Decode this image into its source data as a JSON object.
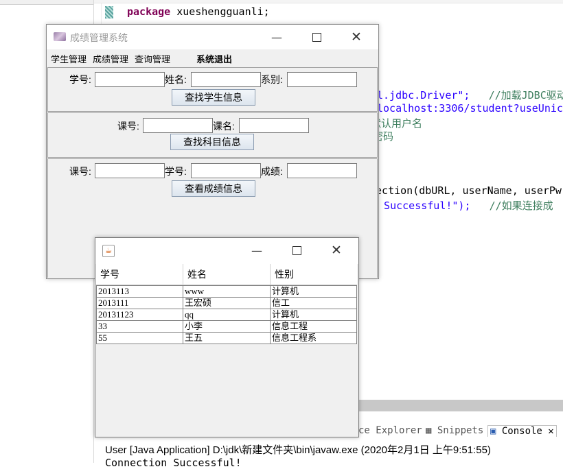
{
  "ide": {
    "code_lines": [
      {
        "kw": "package",
        "text": " xueshengguanli;"
      },
      {
        "text": "l.jdbc.Driver\";   ",
        "comment": "//加载JDBC驱动"
      },
      {
        "text": "localhost:3306/student?useUnico"
      },
      {
        "comment": "默认用户名"
      },
      {
        "comment": "密码"
      },
      {
        "text": "nection(dbURL, userName, userPw"
      },
      {
        "text": "n Successful!\");   ",
        "comment": "//如果连接成"
      }
    ],
    "tabs": {
      "explorer": "ce Explorer",
      "snippets": "Snippets",
      "console": "Console"
    },
    "console_header": "User [Java Application] D:\\jdk\\新建文件夹\\bin\\javaw.exe (2020年2月1日 上午9:51:55)",
    "console_output": "Connection Successful!"
  },
  "main_window": {
    "title": "成绩管理系统",
    "menu": [
      "学生管理",
      "成绩管理",
      "查询管理",
      "系统退出"
    ],
    "student_panel": {
      "labels": [
        "学号:",
        "姓名:",
        "系别:"
      ],
      "button": "查找学生信息"
    },
    "course_panel": {
      "labels": [
        "课号:",
        "课名:"
      ],
      "button": "查找科目信息"
    },
    "score_panel": {
      "labels": [
        "课号:",
        "学号:",
        "成绩:"
      ],
      "button": "查看成绩信息"
    }
  },
  "table_window": {
    "columns": [
      "学号",
      "姓名",
      "性别"
    ],
    "rows": [
      [
        "2013113",
        "www",
        "计算机"
      ],
      [
        "2013111",
        "王宏硕",
        "信工"
      ],
      [
        "20131123",
        "qq",
        "计算机"
      ],
      [
        "33",
        "小李",
        "信息工程"
      ],
      [
        "55",
        "王五",
        "信息工程系"
      ]
    ]
  }
}
